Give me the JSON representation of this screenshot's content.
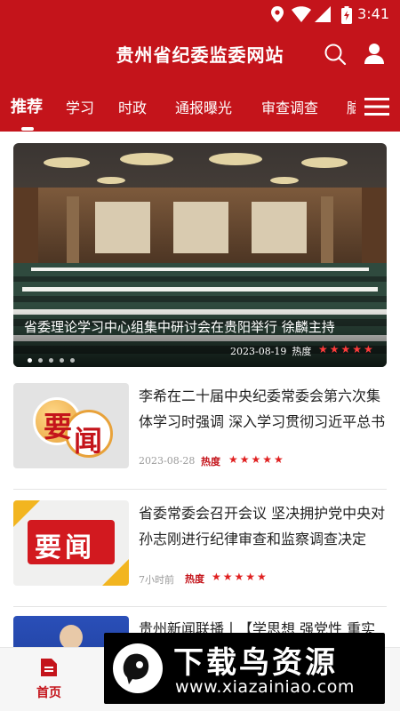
{
  "status_bar": {
    "time": "3:41"
  },
  "app_bar": {
    "title": "贵州省纪委监委网站"
  },
  "tabs": [
    {
      "label": "推荐"
    },
    {
      "label": "学习"
    },
    {
      "label": "时政"
    },
    {
      "label": "通报曝光"
    },
    {
      "label": "审查调查"
    },
    {
      "label": "脑"
    }
  ],
  "banner": {
    "caption": "省委理论学习中心组集中研讨会在贵阳举行 徐麟主持",
    "date": "2023-08-19",
    "heat_label": "热度",
    "stars": "★★★★★"
  },
  "news": [
    {
      "title": "李希在二十届中央纪委常委会第六次集体学习时强调 深入学习贯彻习近平总书记",
      "date": "2023-08-28",
      "heat_label": "热度",
      "stars": "★★★★★",
      "thumb_text": [
        "要",
        "闻"
      ]
    },
    {
      "title": "省委常委会召开会议 坚决拥护党中央对孙志刚进行纪律审查和监察调查决定",
      "date": "7小时前",
      "heat_label": "热度",
      "stars": "★★★★★",
      "thumb_text": "要闻"
    },
    {
      "title": "贵州新闻联播丨【学思想 强党性 重实践 建新功】"
    }
  ],
  "bottom_nav": {
    "home_label": "首页"
  },
  "watermark": {
    "title": "下载鸟资源",
    "url": "www.xiazainiao.com"
  },
  "colors": {
    "brand_red": "#c4141b",
    "star_red": "#e02020"
  }
}
